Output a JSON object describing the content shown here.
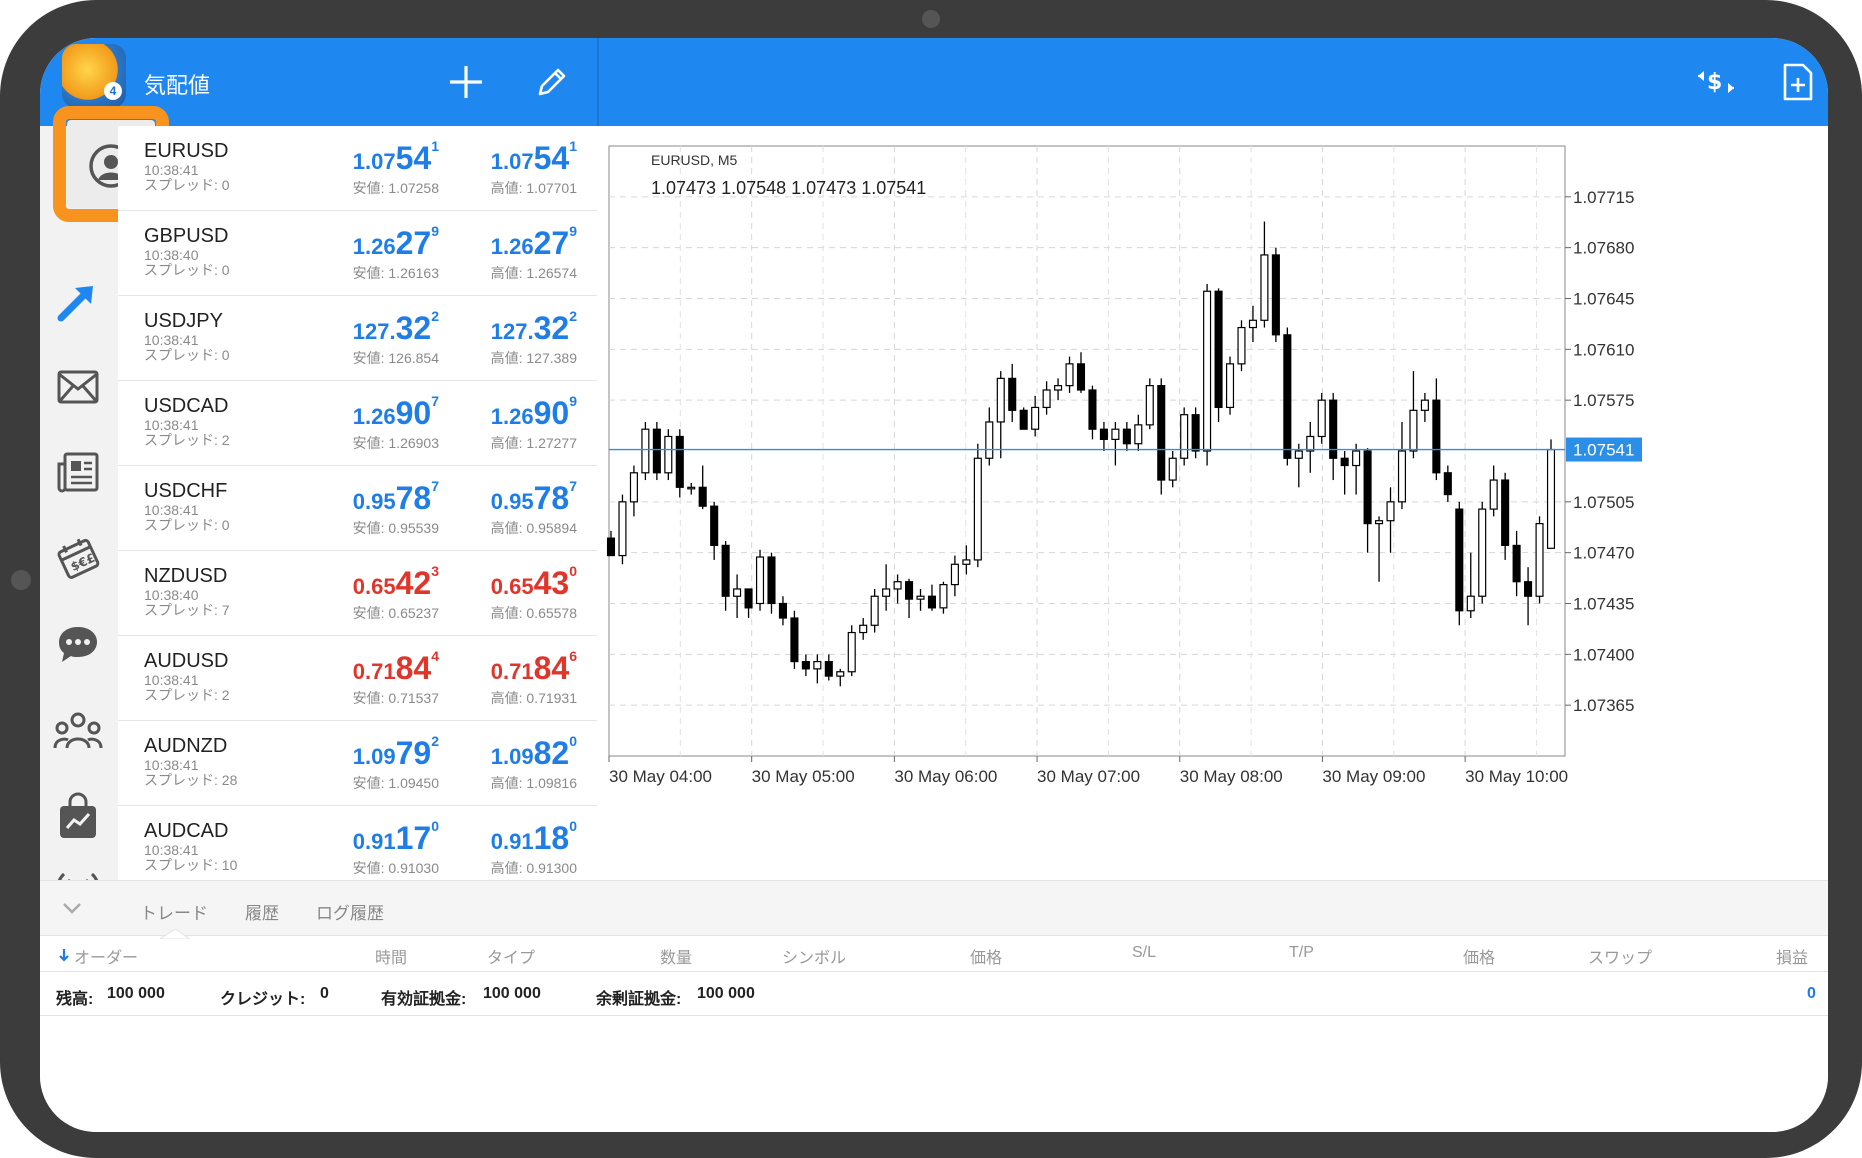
{
  "header": {
    "title": "気配値",
    "logo_badge": "4",
    "accent_color": "#1e88f0"
  },
  "sidebar": {
    "items": [
      {
        "icon": "account-icon",
        "selected": true
      },
      {
        "icon": "trade-arrow-icon"
      },
      {
        "icon": "mail-icon"
      },
      {
        "icon": "news-icon"
      },
      {
        "icon": "calendar-icon"
      },
      {
        "icon": "chat-icon"
      },
      {
        "icon": "community-icon"
      },
      {
        "icon": "market-bag-icon"
      },
      {
        "icon": "signals-icon"
      }
    ],
    "highlight_color": "#f7931e"
  },
  "quotes": [
    {
      "symbol": "EURUSD",
      "time": "10:38:41",
      "spread": "スプレッド: 0",
      "bid": {
        "a": "1.07",
        "b": "54",
        "c": "1"
      },
      "ask": {
        "a": "1.07",
        "b": "54",
        "c": "1"
      },
      "low": "安値: 1.07258",
      "high": "高値: 1.07701",
      "color": "blue"
    },
    {
      "symbol": "GBPUSD",
      "time": "10:38:40",
      "spread": "スプレッド: 0",
      "bid": {
        "a": "1.26",
        "b": "27",
        "c": "9"
      },
      "ask": {
        "a": "1.26",
        "b": "27",
        "c": "9"
      },
      "low": "安値: 1.26163",
      "high": "高値: 1.26574",
      "color": "blue"
    },
    {
      "symbol": "USDJPY",
      "time": "10:38:41",
      "spread": "スプレッド: 0",
      "bid": {
        "a": "127.",
        "b": "32",
        "c": "2"
      },
      "ask": {
        "a": "127.",
        "b": "32",
        "c": "2"
      },
      "low": "安値: 126.854",
      "high": "高値: 127.389",
      "color": "blue"
    },
    {
      "symbol": "USDCAD",
      "time": "10:38:41",
      "spread": "スプレッド: 2",
      "bid": {
        "a": "1.26",
        "b": "90",
        "c": "7"
      },
      "ask": {
        "a": "1.26",
        "b": "90",
        "c": "9"
      },
      "low": "安値: 1.26903",
      "high": "高値: 1.27277",
      "color": "blue"
    },
    {
      "symbol": "USDCHF",
      "time": "10:38:41",
      "spread": "スプレッド: 0",
      "bid": {
        "a": "0.95",
        "b": "78",
        "c": "7"
      },
      "ask": {
        "a": "0.95",
        "b": "78",
        "c": "7"
      },
      "low": "安値: 0.95539",
      "high": "高値: 0.95894",
      "color": "blue"
    },
    {
      "symbol": "NZDUSD",
      "time": "10:38:40",
      "spread": "スプレッド: 7",
      "bid": {
        "a": "0.65",
        "b": "42",
        "c": "3"
      },
      "ask": {
        "a": "0.65",
        "b": "43",
        "c": "0"
      },
      "low": "安値: 0.65237",
      "high": "高値: 0.65578",
      "color": "red"
    },
    {
      "symbol": "AUDUSD",
      "time": "10:38:41",
      "spread": "スプレッド: 2",
      "bid": {
        "a": "0.71",
        "b": "84",
        "c": "4"
      },
      "ask": {
        "a": "0.71",
        "b": "84",
        "c": "6"
      },
      "low": "安値: 0.71537",
      "high": "高値: 0.71931",
      "color": "red"
    },
    {
      "symbol": "AUDNZD",
      "time": "10:38:41",
      "spread": "スプレッド: 28",
      "bid": {
        "a": "1.09",
        "b": "79",
        "c": "2"
      },
      "ask": {
        "a": "1.09",
        "b": "82",
        "c": "0"
      },
      "low": "安値: 1.09450",
      "high": "高値: 1.09816",
      "color": "blue"
    },
    {
      "symbol": "AUDCAD",
      "time": "10:38:41",
      "spread": "スプレッド: 10",
      "bid": {
        "a": "0.91",
        "b": "17",
        "c": "0"
      },
      "ask": {
        "a": "0.91",
        "b": "18",
        "c": "0"
      },
      "low": "安値: 0.91030",
      "high": "高値: 0.91300",
      "color": "blue"
    }
  ],
  "chart_data": {
    "type": "candlestick",
    "symbol_label": "EURUSD, M5",
    "ohlc_label": "1.07473 1.07548 1.07473 1.07541",
    "current_price": 1.07541,
    "current_price_label": "1.07541",
    "ylim": [
      1.0733,
      1.0775
    ],
    "y_ticks": [
      1.07715,
      1.0768,
      1.07645,
      1.0761,
      1.07575,
      1.07505,
      1.0747,
      1.07435,
      1.074,
      1.07365
    ],
    "y_tick_labels": [
      "1.07715",
      "1.07680",
      "1.07645",
      "1.07610",
      "1.07575",
      "1.07505",
      "1.07470",
      "1.07435",
      "1.07400",
      "1.07365"
    ],
    "x_labels": [
      "30 May 04:00",
      "30 May 05:00",
      "30 May 06:00",
      "30 May 07:00",
      "30 May 08:00",
      "30 May 09:00",
      "30 May 10:00"
    ],
    "grid": true,
    "up_color": "#ffffff",
    "down_color": "#000000",
    "candles": [
      [
        1.0748,
        1.07485,
        1.07468,
        1.07468
      ],
      [
        1.07468,
        1.0751,
        1.07462,
        1.07505
      ],
      [
        1.07505,
        1.0753,
        1.07495,
        1.07525
      ],
      [
        1.07525,
        1.0756,
        1.0752,
        1.07555
      ],
      [
        1.07555,
        1.0756,
        1.0752,
        1.07525
      ],
      [
        1.07525,
        1.07555,
        1.0752,
        1.0755
      ],
      [
        1.0755,
        1.07555,
        1.07508,
        1.07515
      ],
      [
        1.07515,
        1.07518,
        1.0751,
        1.07515
      ],
      [
        1.07515,
        1.0753,
        1.075,
        1.07502
      ],
      [
        1.07502,
        1.07505,
        1.07465,
        1.07475
      ],
      [
        1.07475,
        1.07478,
        1.0743,
        1.0744
      ],
      [
        1.0744,
        1.07455,
        1.07425,
        1.07445
      ],
      [
        1.07445,
        1.0744,
        1.07425,
        1.07432
      ],
      [
        1.07435,
        1.07472,
        1.0743,
        1.07467
      ],
      [
        1.07467,
        1.0747,
        1.07428,
        1.07435
      ],
      [
        1.07435,
        1.0744,
        1.0742,
        1.07425
      ],
      [
        1.07425,
        1.0743,
        1.0739,
        1.07395
      ],
      [
        1.07395,
        1.074,
        1.07385,
        1.0739
      ],
      [
        1.0739,
        1.074,
        1.0738,
        1.07395
      ],
      [
        1.07395,
        1.074,
        1.07382,
        1.07385
      ],
      [
        1.07385,
        1.0739,
        1.07378,
        1.07388
      ],
      [
        1.07388,
        1.0742,
        1.07385,
        1.07415
      ],
      [
        1.07415,
        1.07425,
        1.0741,
        1.0742
      ],
      [
        1.0742,
        1.07445,
        1.07415,
        1.0744
      ],
      [
        1.0744,
        1.07462,
        1.0743,
        1.07445
      ],
      [
        1.07445,
        1.07455,
        1.07435,
        1.0745
      ],
      [
        1.0745,
        1.07452,
        1.07425,
        1.07438
      ],
      [
        1.07438,
        1.07445,
        1.0743,
        1.0744
      ],
      [
        1.0744,
        1.07448,
        1.0743,
        1.07432
      ],
      [
        1.07432,
        1.0745,
        1.07428,
        1.07448
      ],
      [
        1.07448,
        1.07468,
        1.0744,
        1.07462
      ],
      [
        1.07462,
        1.07475,
        1.07455,
        1.07465
      ],
      [
        1.07465,
        1.07545,
        1.0746,
        1.07535
      ],
      [
        1.07535,
        1.0757,
        1.0753,
        1.0756
      ],
      [
        1.0756,
        1.07595,
        1.07535,
        1.0759
      ],
      [
        1.0759,
        1.076,
        1.0756,
        1.07568
      ],
      [
        1.07568,
        1.0757,
        1.07555,
        1.07555
      ],
      [
        1.07555,
        1.07578,
        1.0755,
        1.0757
      ],
      [
        1.0757,
        1.07588,
        1.07565,
        1.07582
      ],
      [
        1.07582,
        1.0759,
        1.07575,
        1.07585
      ],
      [
        1.07585,
        1.07605,
        1.0758,
        1.076
      ],
      [
        1.076,
        1.07608,
        1.0758,
        1.07582
      ],
      [
        1.07582,
        1.07585,
        1.07548,
        1.07555
      ],
      [
        1.07555,
        1.0756,
        1.0754,
        1.07548
      ],
      [
        1.07548,
        1.0756,
        1.0753,
        1.07555
      ],
      [
        1.07555,
        1.0756,
        1.0754,
        1.07545
      ],
      [
        1.07545,
        1.07565,
        1.0754,
        1.07558
      ],
      [
        1.07558,
        1.0759,
        1.07555,
        1.07585
      ],
      [
        1.07585,
        1.0759,
        1.0751,
        1.0752
      ],
      [
        1.0752,
        1.0754,
        1.07515,
        1.07535
      ],
      [
        1.07535,
        1.0757,
        1.0753,
        1.07565
      ],
      [
        1.07565,
        1.0757,
        1.07535,
        1.0754
      ],
      [
        1.0754,
        1.07655,
        1.0753,
        1.0765
      ],
      [
        1.0765,
        1.07652,
        1.0756,
        1.0757
      ],
      [
        1.0757,
        1.07605,
        1.07565,
        1.076
      ],
      [
        1.076,
        1.0763,
        1.07595,
        1.07625
      ],
      [
        1.07625,
        1.0764,
        1.07615,
        1.0763
      ],
      [
        1.0763,
        1.07698,
        1.07625,
        1.07675
      ],
      [
        1.07675,
        1.0768,
        1.07615,
        1.0762
      ],
      [
        1.0762,
        1.07625,
        1.0753,
        1.07535
      ],
      [
        1.07535,
        1.07545,
        1.07515,
        1.0754
      ],
      [
        1.0754,
        1.0756,
        1.07525,
        1.0755
      ],
      [
        1.0755,
        1.0758,
        1.07545,
        1.07575
      ],
      [
        1.07575,
        1.0758,
        1.0752,
        1.07535
      ],
      [
        1.07535,
        1.0754,
        1.0751,
        1.0753
      ],
      [
        1.0753,
        1.07545,
        1.0751,
        1.0754
      ],
      [
        1.0754,
        1.07542,
        1.0747,
        1.0749
      ],
      [
        1.0749,
        1.07495,
        1.0745,
        1.07492
      ],
      [
        1.07492,
        1.07515,
        1.0747,
        1.07505
      ],
      [
        1.07505,
        1.0756,
        1.075,
        1.0754
      ],
      [
        1.0754,
        1.07595,
        1.07535,
        1.07568
      ],
      [
        1.07568,
        1.0758,
        1.0756,
        1.07575
      ],
      [
        1.07575,
        1.0759,
        1.0752,
        1.07525
      ],
      [
        1.07525,
        1.0753,
        1.07505,
        1.0751
      ],
      [
        1.075,
        1.07505,
        1.0742,
        1.0743
      ],
      [
        1.0743,
        1.0747,
        1.07425,
        1.0744
      ],
      [
        1.0744,
        1.07505,
        1.07435,
        1.075
      ],
      [
        1.075,
        1.0753,
        1.07495,
        1.0752
      ],
      [
        1.0752,
        1.07525,
        1.07465,
        1.07475
      ],
      [
        1.07475,
        1.07485,
        1.0744,
        1.0745
      ],
      [
        1.0745,
        1.0746,
        1.0742,
        1.0744
      ],
      [
        1.0744,
        1.07495,
        1.07435,
        1.0749
      ],
      [
        1.07473,
        1.07548,
        1.07473,
        1.07541
      ]
    ]
  },
  "bottom": {
    "tabs": [
      "トレード",
      "履歴",
      "ログ履歴"
    ],
    "columns": [
      "オーダー",
      "時間",
      "タイプ",
      "数量",
      "シンボル",
      "価格",
      "S/L",
      "T/P",
      "価格",
      "スワップ",
      "損益"
    ],
    "balance": [
      {
        "label": "残高:",
        "value": "100 000"
      },
      {
        "label": "クレジット:",
        "value": "0"
      },
      {
        "label": "有効証拠金:",
        "value": "100 000"
      },
      {
        "label": "余剰証拠金:",
        "value": "100 000"
      }
    ],
    "profit_total": "0"
  }
}
